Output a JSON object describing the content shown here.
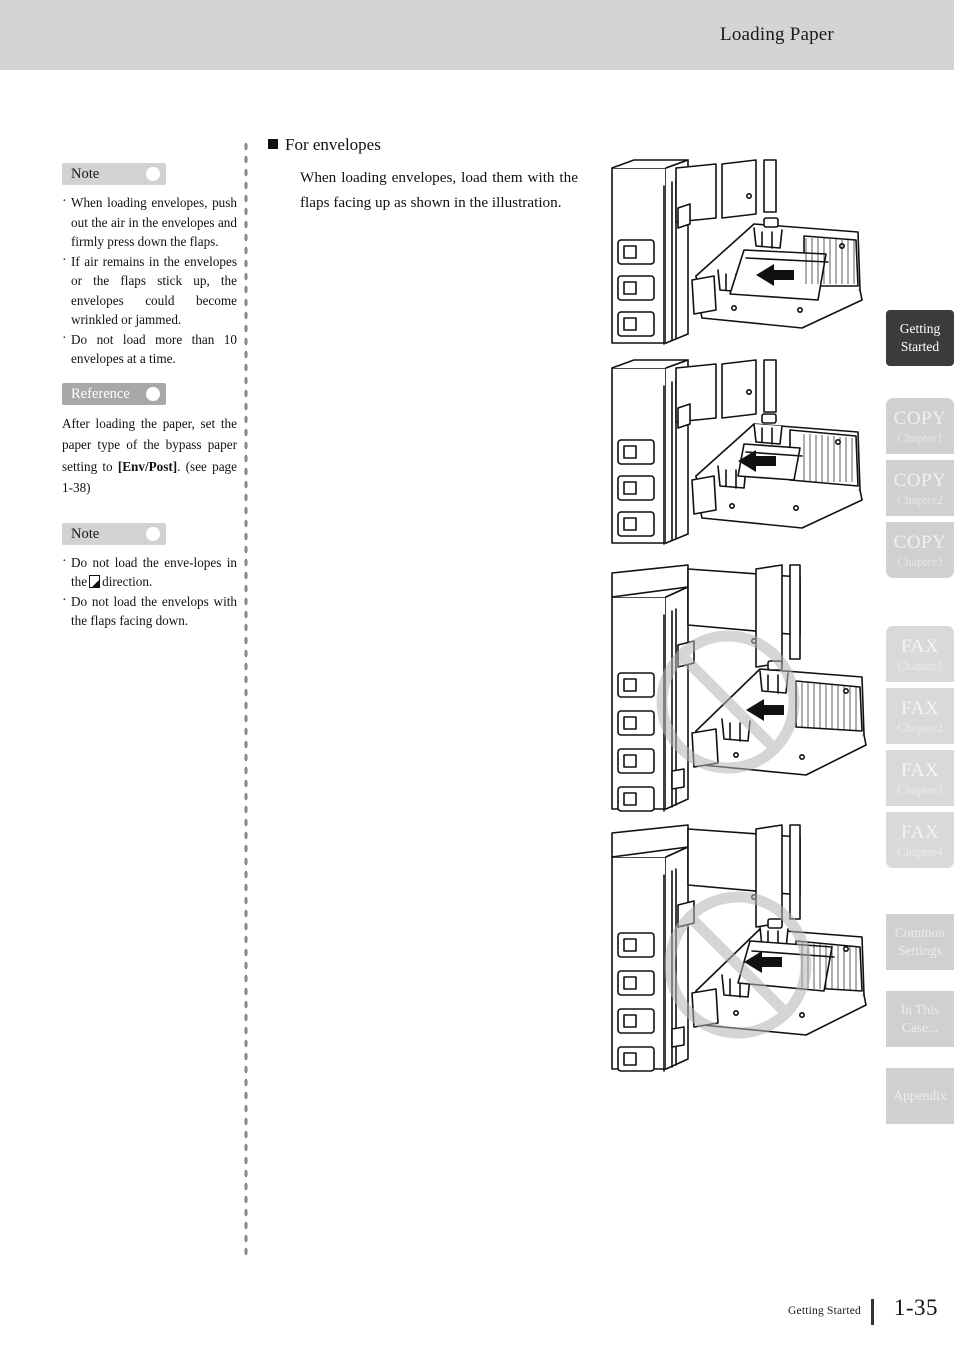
{
  "header": {
    "title": "Loading Paper"
  },
  "main": {
    "heading": "For envelopes",
    "body": "When loading envelopes, load them with the flaps facing up as shown in the illustration."
  },
  "callouts": [
    {
      "label": "Note",
      "type": "note",
      "items": [
        "When loading envelopes, push out the air in the envelopes and firmly press down the flaps.",
        "If air remains in the envelopes or the flaps stick up, the envelopes could become wrinkled or jammed.",
        "Do not load more than 10 envelopes at a time."
      ]
    },
    {
      "label": "Reference",
      "type": "reference",
      "paragraph_prefix": "After loading the paper, set the paper type of the bypass paper setting to ",
      "paragraph_bold": "[Env/Post]",
      "paragraph_suffix": ". (see page 1-38)"
    },
    {
      "label": "Note",
      "type": "note",
      "items": [
        "Do not load the envelopes in the   direction.",
        "Do not load the envelops with the flaps facing down."
      ],
      "item1_before": "Do not load the enve-lopes in the",
      "item1_after": "direction."
    }
  ],
  "figures": [
    {
      "caption": "bypass-tray-envelopes-correct-flaps-up",
      "prohibited": false
    },
    {
      "caption": "bypass-tray-envelopes-correct-short-edge",
      "prohibited": false
    },
    {
      "caption": "bypass-tray-envelopes-wrong-direction",
      "prohibited": true
    },
    {
      "caption": "bypass-tray-envelopes-wrong-flaps-down",
      "prohibited": true
    }
  ],
  "tabs": [
    {
      "line1": "Getting",
      "line2": "Started",
      "style": "active",
      "active": true
    },
    {
      "line1": "COPY",
      "line2": "Chapter1",
      "style": "copy",
      "active": false
    },
    {
      "line1": "COPY",
      "line2": "Chapter2",
      "style": "copy",
      "active": false
    },
    {
      "line1": "COPY",
      "line2": "Chapter3",
      "style": "copy",
      "active": false
    },
    {
      "line1": "FAX",
      "line2": "Chapter1",
      "style": "fax",
      "active": false
    },
    {
      "line1": "FAX",
      "line2": "Chapter2",
      "style": "fax",
      "active": false
    },
    {
      "line1": "FAX",
      "line2": "Chapter3",
      "style": "fax",
      "active": false
    },
    {
      "line1": "FAX",
      "line2": "Chapter4",
      "style": "fax",
      "active": false
    },
    {
      "line1": "Common",
      "line2": "Settings",
      "style": "plain",
      "active": false
    },
    {
      "line1": "In This",
      "line2": "Case...",
      "style": "plain",
      "active": false
    },
    {
      "line1": "Appendix",
      "line2": "",
      "style": "plain",
      "active": false
    }
  ],
  "footer": {
    "chapter": "Getting Started",
    "page": "1-35"
  },
  "colors": {
    "header_band": "#d4d4d4",
    "active_tab": "#3c3c3c",
    "copy_tab": "#d0d0d0",
    "fax_tab": "#d9d9d9",
    "note_label": "#d2d2d2",
    "reference_label": "#a8a8a8",
    "prohibition_symbol": "#c8c8c8"
  }
}
